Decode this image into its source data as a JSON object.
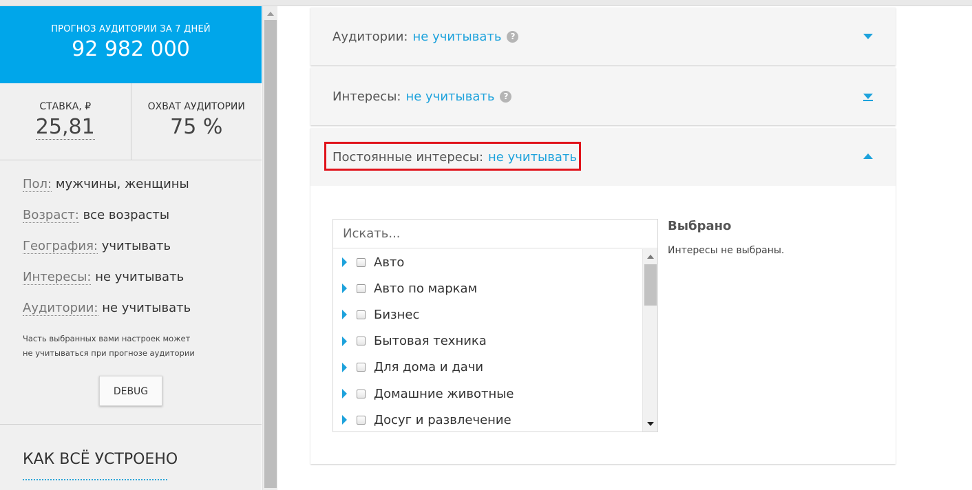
{
  "sidebar": {
    "forecast_title": "ПРОГНОЗ АУДИТОРИИ ЗА 7 ДНЕЙ",
    "forecast_value": "92 982 000",
    "rate_title": "СТАВКА, ₽",
    "rate_value": "25,81",
    "reach_title": "ОХВАТ АУДИТОРИИ",
    "reach_value": "75 %",
    "params": [
      {
        "key": "Пол:",
        "value": "мужчины, женщины"
      },
      {
        "key": "Возраст:",
        "value": "все возрасты"
      },
      {
        "key": "География:",
        "value": "учитывать"
      },
      {
        "key": "Интересы:",
        "value": "не учитывать"
      },
      {
        "key": "Аудитории:",
        "value": "не учитывать"
      }
    ],
    "note_line1": "Часть выбранных вами настроек может",
    "note_line2": "не учитываться при прогнозе аудитории",
    "debug_label": "DEBUG",
    "how_title": "КАК ВСЁ УСТРОЕНО"
  },
  "accordion": {
    "audiences": {
      "label": "Аудитории:",
      "value": "не учитывать",
      "help": "?"
    },
    "interests": {
      "label": "Интересы:",
      "value": "не учитывать",
      "help": "?"
    },
    "permanent": {
      "label": "Постоянные интересы:",
      "value": "не учитывать"
    }
  },
  "picker": {
    "search_placeholder": "Искать...",
    "items": [
      "Авто",
      "Авто по маркам",
      "Бизнес",
      "Бытовая техника",
      "Для дома и дачи",
      "Домашние животные",
      "Досуг и развлечение"
    ],
    "selected_title": "Выбрано",
    "selected_empty": "Интересы не выбраны."
  },
  "colors": {
    "accent": "#1da2dc",
    "forecast_bg": "#00a6ea",
    "highlight": "#e0131b"
  }
}
